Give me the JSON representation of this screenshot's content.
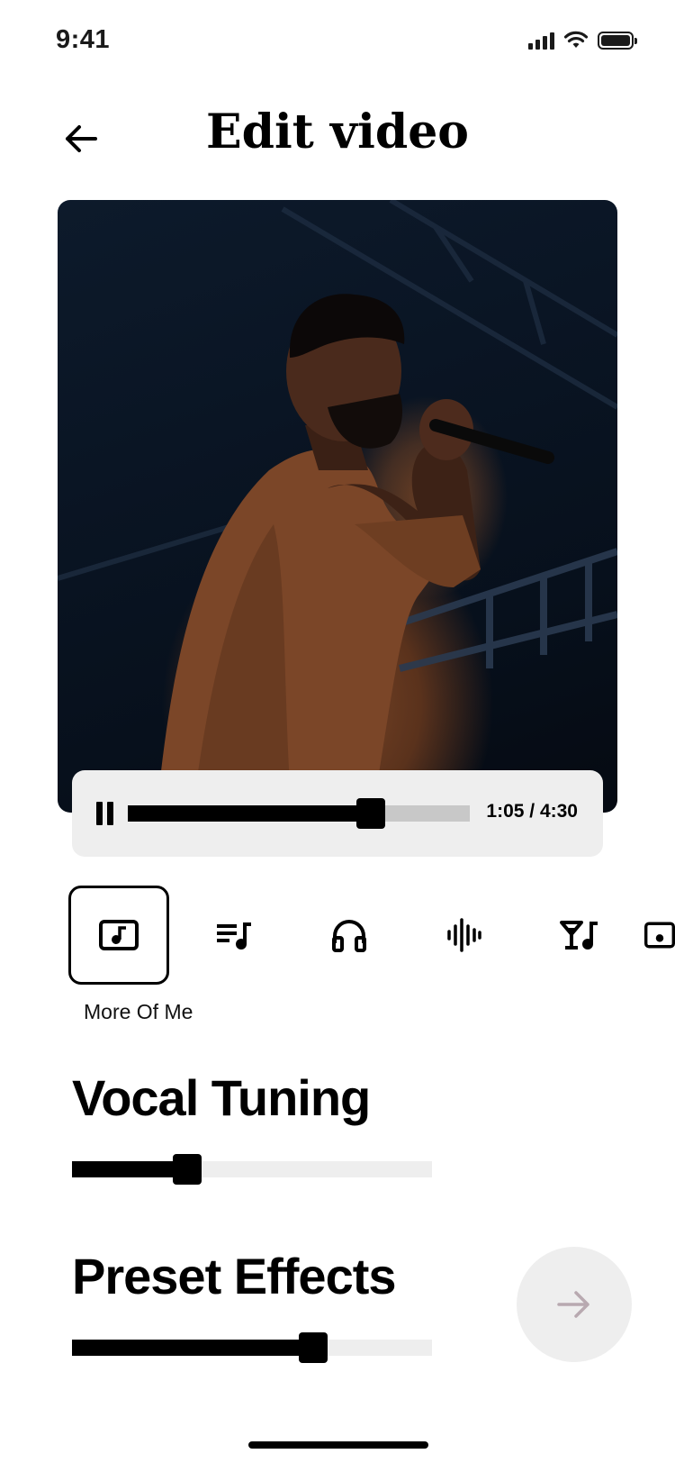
{
  "status_bar": {
    "time": "9:41"
  },
  "header": {
    "title": "Edit video"
  },
  "player": {
    "time_display": "1:05 / 4:30",
    "progress": 0.71
  },
  "tools": {
    "items": [
      {
        "icon": "music-note-square-icon",
        "selected": true
      },
      {
        "icon": "playlist-icon",
        "selected": false
      },
      {
        "icon": "headphones-icon",
        "selected": false
      },
      {
        "icon": "waveform-icon",
        "selected": false
      },
      {
        "icon": "cocktail-music-icon",
        "selected": false
      },
      {
        "icon": "media-icon",
        "selected": false
      }
    ],
    "selected_label": "More Of Me"
  },
  "vocal_tuning": {
    "title": "Vocal Tuning",
    "value": 0.32
  },
  "preset_effects": {
    "title": "Preset Effects",
    "value": 0.67
  },
  "colors": {
    "accent": "#000000",
    "surface": "#eeeeee",
    "next_arrow": "#b8a9b0"
  }
}
